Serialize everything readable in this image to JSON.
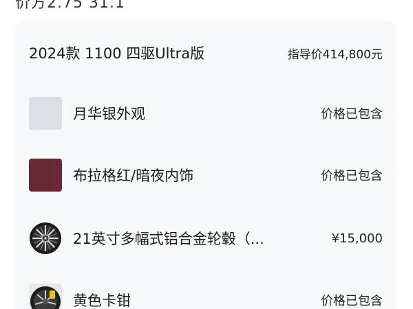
{
  "top_cut_text": "价方2.75 31.1",
  "config": {
    "model_title": "2024款 1100 四驱Ultra版",
    "guide_price": "指导价414,800元"
  },
  "options": [
    {
      "label": "月华银外观",
      "price": "价格已包含",
      "icon": "silver-swatch",
      "color": "#dcdfe4"
    },
    {
      "label": "布拉格红/暗夜内饰",
      "price": "价格已包含",
      "icon": "red-swatch",
      "color": "#6d2a37"
    },
    {
      "label": "21英寸多幅式铝合金轮毂（...",
      "price": "¥15,000",
      "icon": "wheel-icon"
    },
    {
      "label": "黄色卡钳",
      "price": "价格已包含",
      "icon": "caliper-icon"
    }
  ]
}
